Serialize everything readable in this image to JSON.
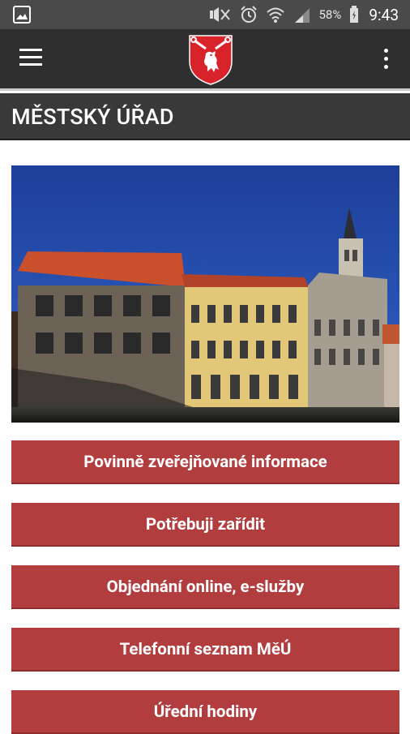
{
  "status_bar": {
    "battery_percent": "58%",
    "time": "9:43",
    "icons": [
      "image-icon",
      "mute-icon",
      "alarm-icon",
      "wifi-icon",
      "signal-icon",
      "battery-icon"
    ]
  },
  "app_bar": {
    "icons": [
      "menu-icon",
      "city-crest-logo",
      "more-vert-icon"
    ]
  },
  "page": {
    "title": "MĚSTSKÝ ÚŘAD"
  },
  "menu": {
    "items": [
      {
        "label": "Povinně zveřejňované informace"
      },
      {
        "label": "Potřebuji zařídit"
      },
      {
        "label": "Objednání online, e-služby"
      },
      {
        "label": "Telefonní seznam MěÚ"
      },
      {
        "label": "Úřední hodiny"
      }
    ]
  },
  "colors": {
    "status_bar": "#4a4a4a",
    "app_bar": "#2f2f2f",
    "title_bar": "#393939",
    "button": "#b13d3f",
    "crest_red": "#d8232a"
  }
}
